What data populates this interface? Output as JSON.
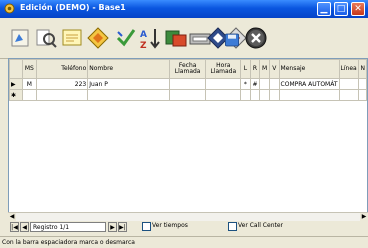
{
  "window": {
    "title": "Edición (DEMO) - Base1"
  },
  "toolbar": {
    "buttons": [
      "call-tool-icon",
      "search-tool-icon",
      "notes-tool-icon",
      "diamond-tool-icon",
      "check-tool-icon",
      "sort-az-icon",
      "import-icon",
      "export-icon",
      "tag-icon",
      "print-icon",
      "disk-icon",
      "cancel-icon"
    ]
  },
  "grid": {
    "headers": [
      "MS",
      "Teléfono",
      "Nombre",
      "Fecha Llamada",
      "Hora Llamada",
      "L",
      "R",
      "M",
      "V",
      "Mensaje",
      "Línea",
      "N"
    ],
    "rows": [
      {
        "marker": "▶",
        "ms": "M",
        "telefono": "223",
        "nombre": "Juan P",
        "fecha": "",
        "hora": "",
        "l": "*",
        "r": "#",
        "m": "",
        "v": "",
        "mensaje": "COMPRA AUTOMÁT",
        "linea": "",
        "n": ""
      },
      {
        "marker": "✱",
        "ms": "",
        "telefono": "",
        "nombre": "",
        "fecha": "",
        "hora": "",
        "l": "",
        "r": "",
        "m": "",
        "v": "",
        "mensaje": "",
        "linea": "",
        "n": ""
      }
    ]
  },
  "navigator": {
    "record_label": "Registro 1/1",
    "ver_tiempos": "Ver tiempos",
    "ver_call_center": "Ver Call Center"
  },
  "status_bar": {
    "text": "Con la barra espaciadora marca o desmarca"
  }
}
